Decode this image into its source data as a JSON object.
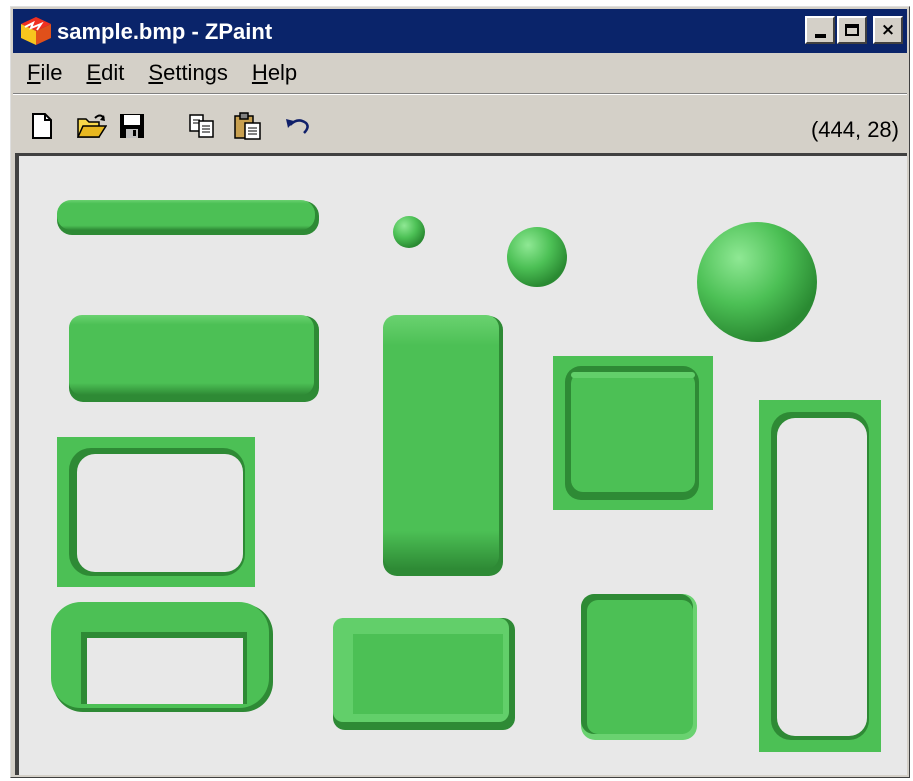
{
  "window": {
    "title": "sample.bmp - ZPaint",
    "icon": "zpaint-app-icon",
    "controls": [
      {
        "name": "minimize-button",
        "icon": "minimize-icon"
      },
      {
        "name": "maximize-button",
        "icon": "maximize-icon"
      },
      {
        "name": "close-button",
        "icon": "close-icon",
        "label": "×"
      }
    ]
  },
  "menu": {
    "items": [
      {
        "label": "File",
        "accel": "F",
        "rest": "ile"
      },
      {
        "label": "Edit",
        "accel": "E",
        "rest": "dit"
      },
      {
        "label": "Settings",
        "accel": "S",
        "rest": "ettings"
      },
      {
        "label": "Help",
        "accel": "H",
        "rest": "elp"
      }
    ]
  },
  "toolbar": {
    "tools": [
      "new-document-icon",
      "open-folder-icon",
      "save-disk-icon",
      "copy-icon",
      "paste-icon",
      "undo-icon"
    ],
    "coordinates": "(444, 28)"
  },
  "canvas": {
    "background": "#e8e8e8",
    "shape_color": "#4cc055",
    "shape_dark": "#2e8a35",
    "shape_light": "#7ad880",
    "shapes": [
      "thin-rounded-bar",
      "small-sphere",
      "medium-sphere",
      "large-sphere",
      "wide-raised-rectangle",
      "tall-raised-rectangle",
      "inset-square-panel",
      "hollow-square-frame",
      "tall-hollow-frame",
      "hollow-rounded-ring",
      "beveled-rectangle",
      "sunken-rectangle"
    ]
  }
}
